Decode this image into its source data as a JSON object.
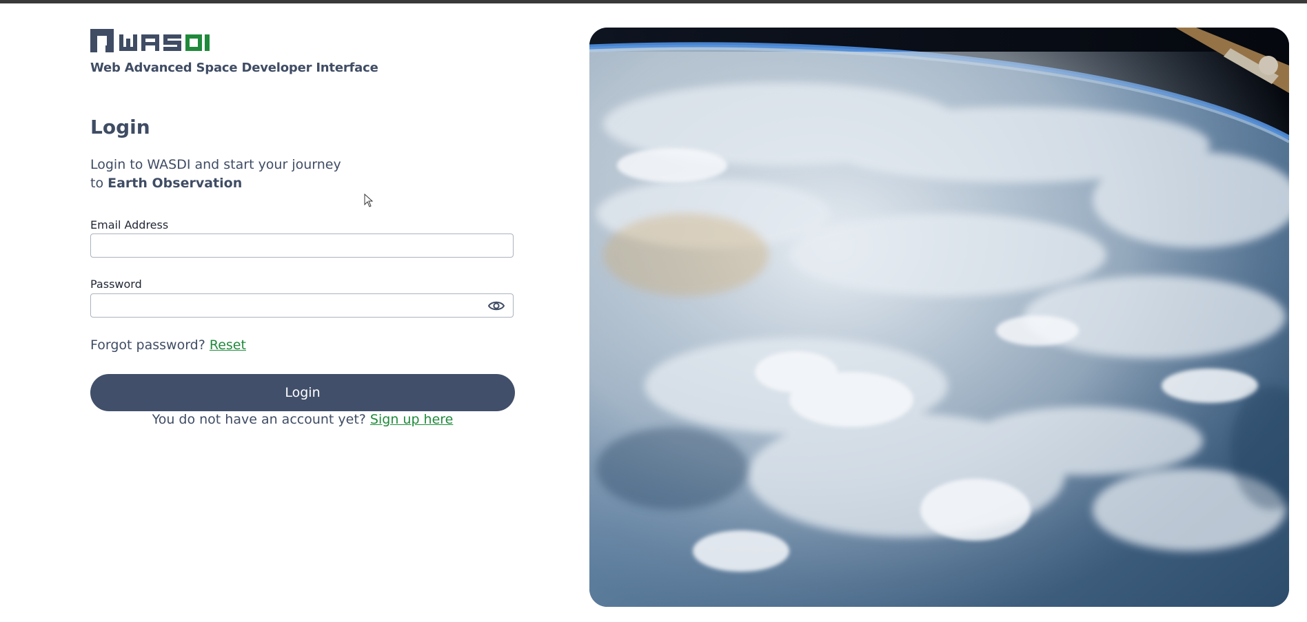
{
  "brand": {
    "logo_text": "WASDI",
    "tagline": "Web Advanced Space Developer Interface",
    "colors": {
      "dark": "#3f4c64",
      "green": "#1f8a3b"
    }
  },
  "login": {
    "title": "Login",
    "intro_line1": "Login to WASDI and start your journey",
    "intro_line2_prefix": "to ",
    "intro_line2_bold": "Earth Observation",
    "email": {
      "label": "Email Address",
      "value": "",
      "placeholder": ""
    },
    "password": {
      "label": "Password",
      "value": "",
      "placeholder": "",
      "toggle_icon": "eye-icon"
    },
    "forgot_text": "Forgot password? ",
    "reset_link": "Reset",
    "submit_label": "Login",
    "signup_text": "You do not have an account yet? ",
    "signup_link": "Sign up here"
  },
  "hero": {
    "image_subject": "Earth from space with clouds"
  }
}
